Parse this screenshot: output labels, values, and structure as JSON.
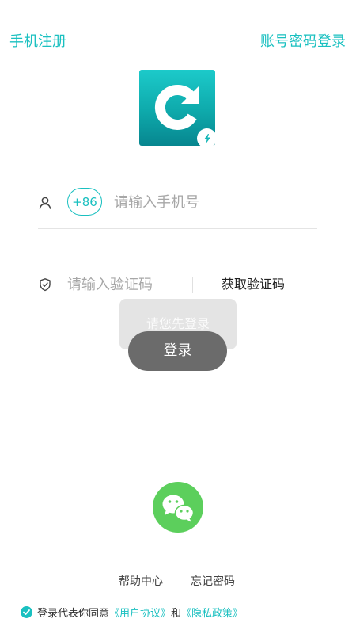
{
  "header": {
    "register_label": "手机注册",
    "account_login_label": "账号密码登录"
  },
  "brand": {
    "logo_icon": "app-logo-g",
    "badge_icon": "lightning-icon"
  },
  "phone_field": {
    "user_icon": "user-icon",
    "country_code": "+86",
    "placeholder": "请输入手机号",
    "value": ""
  },
  "code_field": {
    "shield_icon": "shield-icon",
    "placeholder": "请输入验证码",
    "value": "",
    "get_code_label": "获取验证码"
  },
  "toast": {
    "message": "请您先登录"
  },
  "login": {
    "button_label": "登录"
  },
  "social": {
    "wechat_icon": "wechat-icon"
  },
  "footer": {
    "help_label": "帮助中心",
    "forgot_label": "忘记密码",
    "agreement_prefix": "登录代表你同意",
    "user_agreement": "《用户协议》",
    "conjunction": "和",
    "privacy_policy": "《隐私政策》",
    "agreed": true
  },
  "colors": {
    "accent": "#1ac0c0",
    "login_button": "#6b6b6b",
    "wechat": "#5ccf5c"
  }
}
